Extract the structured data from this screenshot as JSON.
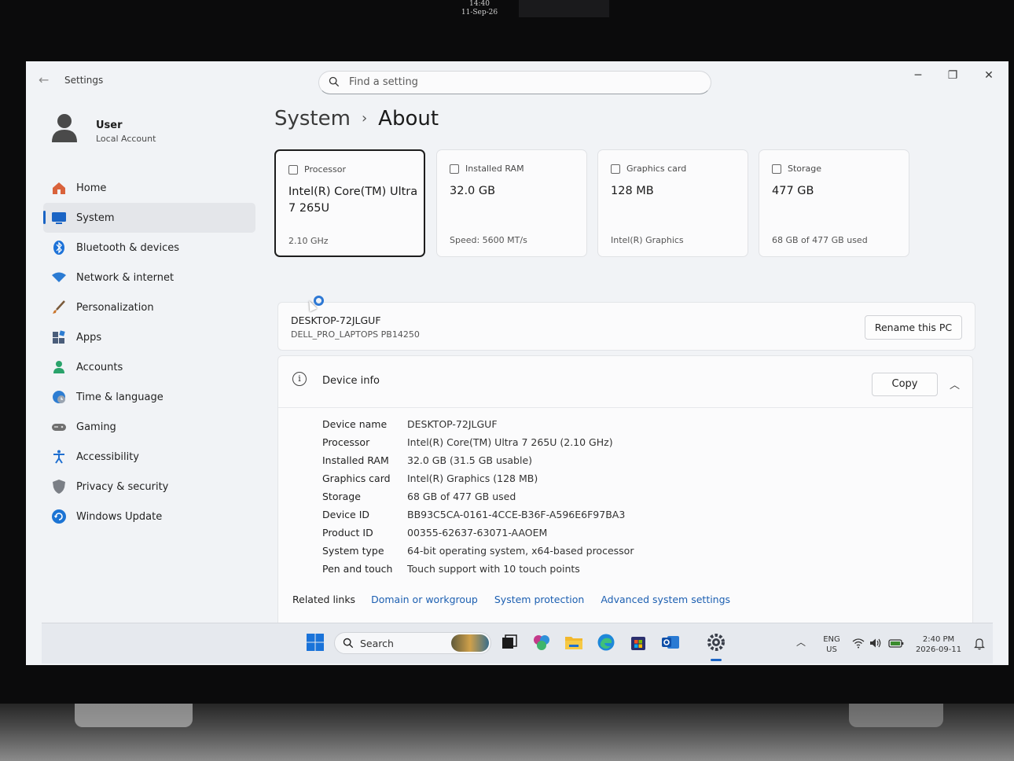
{
  "photo": {
    "clock_time": "14:40",
    "clock_date": "11-Sep-26"
  },
  "window": {
    "title": "Settings",
    "search_placeholder": "Find a setting"
  },
  "profile": {
    "name": "User",
    "account_type": "Local Account"
  },
  "sidebar": {
    "items": [
      {
        "label": "Home",
        "icon": "home-icon",
        "color": "#d9623b"
      },
      {
        "label": "System",
        "icon": "system-icon",
        "color": "#1a64c4",
        "active": true
      },
      {
        "label": "Bluetooth & devices",
        "icon": "bluetooth-icon",
        "color": "#1d72d8"
      },
      {
        "label": "Network & internet",
        "icon": "wifi-icon",
        "color": "#2b7bd3"
      },
      {
        "label": "Personalization",
        "icon": "brush-icon",
        "color": "#c9742b"
      },
      {
        "label": "Apps",
        "icon": "apps-icon",
        "color": "#4a5d7a"
      },
      {
        "label": "Accounts",
        "icon": "accounts-icon",
        "color": "#2aa36b"
      },
      {
        "label": "Time & language",
        "icon": "globe-clock-icon",
        "color": "#2d7dd2"
      },
      {
        "label": "Gaming",
        "icon": "gamepad-icon",
        "color": "#6f6f6f"
      },
      {
        "label": "Accessibility",
        "icon": "accessibility-icon",
        "color": "#1f6fd0"
      },
      {
        "label": "Privacy & security",
        "icon": "shield-icon",
        "color": "#7b7f86"
      },
      {
        "label": "Windows Update",
        "icon": "update-icon",
        "color": "#1c74d4"
      }
    ]
  },
  "breadcrumb": {
    "parent": "System",
    "separator": "›",
    "current": "About"
  },
  "cards": [
    {
      "head": "Processor",
      "value": "Intel(R) Core(TM) Ultra 7 265U",
      "foot": "2.10 GHz"
    },
    {
      "head": "Installed RAM",
      "value": "32.0 GB",
      "foot": "Speed: 5600 MT/s"
    },
    {
      "head": "Graphics card",
      "value": "128 MB",
      "foot": "Intel(R) Graphics"
    },
    {
      "head": "Storage",
      "value": "477 GB",
      "foot": "68 GB of 477 GB used"
    }
  ],
  "device": {
    "name": "DESKTOP-72JLGUF",
    "model": "DELL_PRO_LAPTOPS PB14250",
    "rename_label": "Rename this PC"
  },
  "device_info": {
    "title": "Device info",
    "copy_label": "Copy",
    "specs": [
      {
        "key": "Device name",
        "value": "DESKTOP-72JLGUF"
      },
      {
        "key": "Processor",
        "value": "Intel(R) Core(TM) Ultra 7 265U (2.10 GHz)"
      },
      {
        "key": "Installed RAM",
        "value": "32.0 GB (31.5 GB usable)"
      },
      {
        "key": "Graphics card",
        "value": "Intel(R) Graphics (128 MB)"
      },
      {
        "key": "Storage",
        "value": "68 GB of 477 GB used"
      },
      {
        "key": "Device ID",
        "value": "BB93C5CA-0161-4CCE-B36F-A596E6F97BA3"
      },
      {
        "key": "Product ID",
        "value": "00355-62637-63071-AAOEM"
      },
      {
        "key": "System type",
        "value": "64-bit operating system, x64-based processor"
      },
      {
        "key": "Pen and touch",
        "value": "Touch support with 10 touch points"
      }
    ]
  },
  "related": {
    "label": "Related links",
    "links": [
      "Domain or workgroup",
      "System protection",
      "Advanced system settings"
    ]
  },
  "taskbar": {
    "search_label": "Search",
    "lang_top": "ENG",
    "lang_bottom": "US",
    "time": "2:40 PM",
    "date": "2026-09-11"
  }
}
